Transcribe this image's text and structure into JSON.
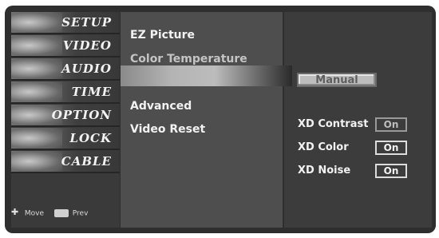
{
  "left_menu": {
    "items": [
      {
        "label": "SETUP"
      },
      {
        "label": "VIDEO"
      },
      {
        "label": "AUDIO"
      },
      {
        "label": "TIME"
      },
      {
        "label": "OPTION"
      },
      {
        "label": "LOCK"
      },
      {
        "label": "CABLE"
      }
    ],
    "footer": {
      "move_label": "Move",
      "prev_label": "Prev",
      "move_icon": "move-arrows-icon",
      "prev_icon": "menu-button-icon"
    }
  },
  "submenu": {
    "items": [
      {
        "label": "EZ Picture"
      },
      {
        "label": "Color Temperature"
      },
      {
        "label": ""
      },
      {
        "label": "Advanced"
      },
      {
        "label": "Video Reset"
      }
    ]
  },
  "detail": {
    "mode_button": "Manual",
    "settings": [
      {
        "label": "XD Contrast",
        "value": "On"
      },
      {
        "label": "XD Color",
        "value": "On"
      },
      {
        "label": "XD Noise",
        "value": "On"
      }
    ]
  },
  "colors": {
    "panel_dark": "#2e2e2e",
    "panel_mid": "#4e4e4e",
    "highlight": "#bcbcbc",
    "text": "#f2f2f2"
  }
}
